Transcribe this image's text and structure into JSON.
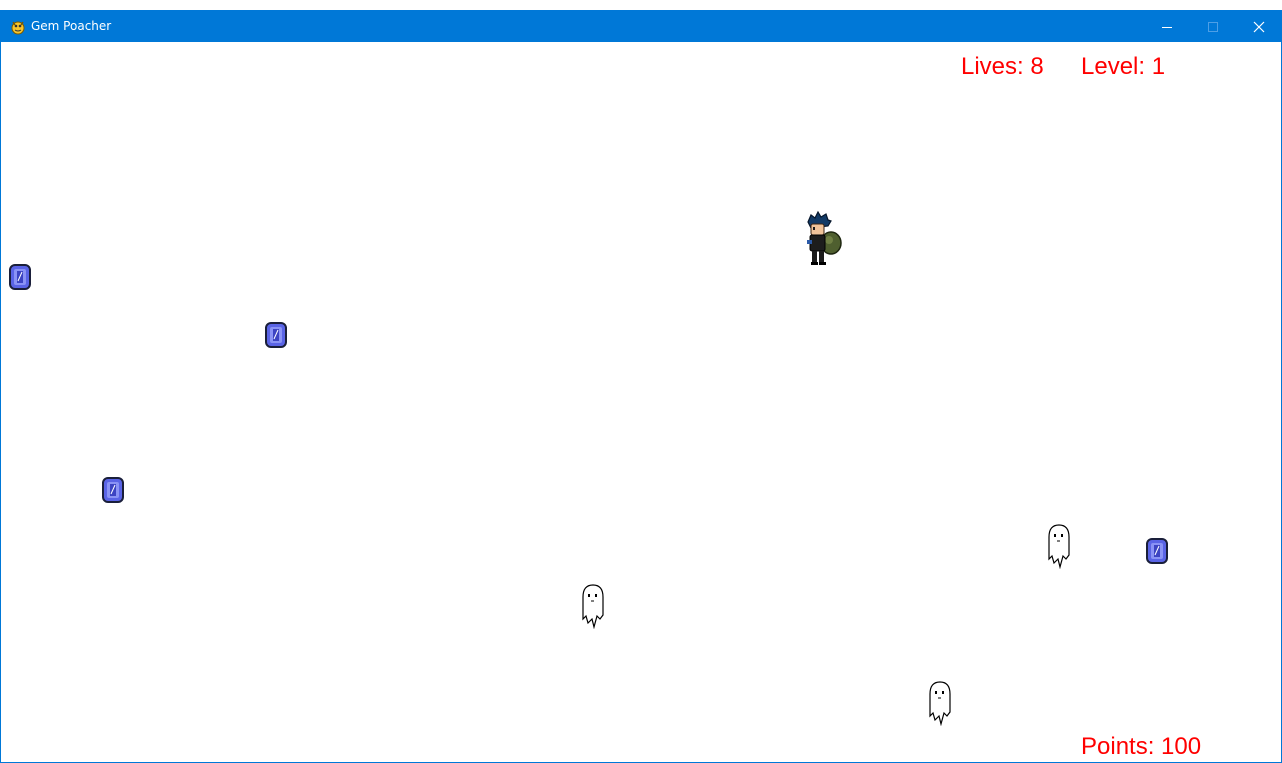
{
  "window": {
    "title": "Gem Poacher",
    "titlebar_color": "#0078d7",
    "controls": [
      "minimize",
      "maximize",
      "close"
    ]
  },
  "hud": {
    "lives_text": "Lives: 8",
    "level_text": "Level: 1",
    "points_text": "Points: 100",
    "text_color": "#ff0000"
  },
  "sprites": {
    "player": "thief-with-sack",
    "gems": [
      "blue-gem",
      "blue-gem",
      "blue-gem",
      "blue-gem"
    ],
    "ghosts": [
      "ghost",
      "ghost",
      "ghost"
    ]
  }
}
